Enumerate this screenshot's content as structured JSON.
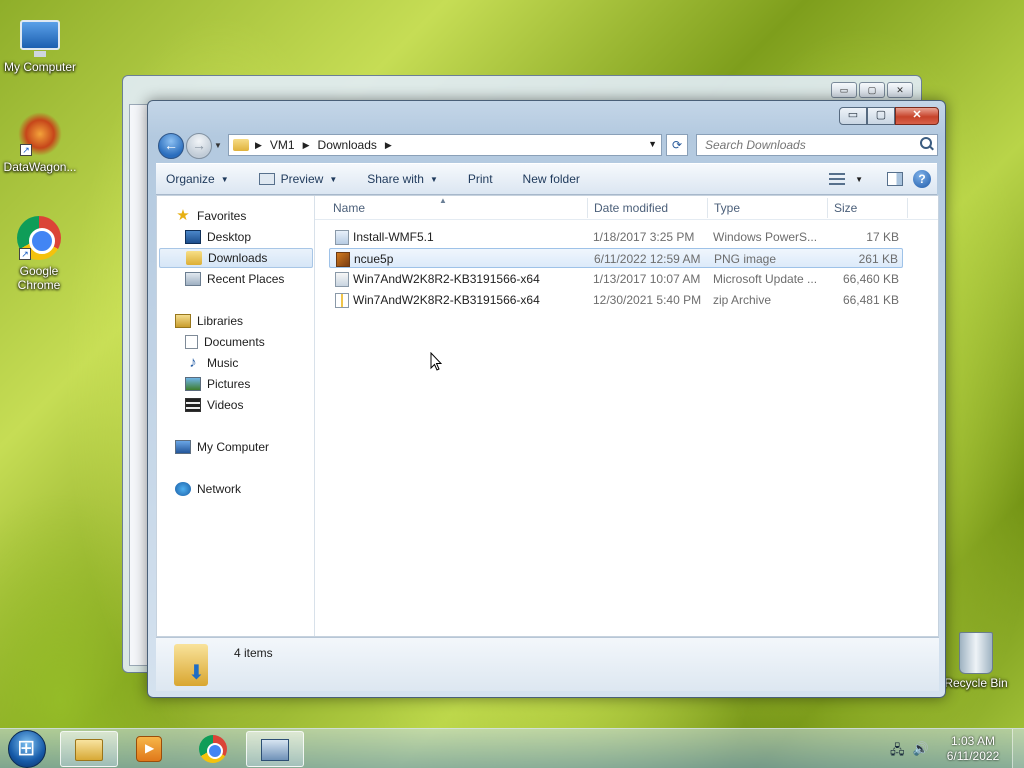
{
  "desktop": {
    "icons": [
      {
        "label": "My Computer"
      },
      {
        "label": "DataWagon..."
      },
      {
        "label": "Google Chrome"
      },
      {
        "label": "Recycle Bin"
      }
    ]
  },
  "explorer": {
    "caption": {
      "minimize": "▭",
      "maximize": "▢",
      "close": "✕"
    },
    "address": {
      "crumbs": [
        "VM1",
        "Downloads"
      ]
    },
    "search": {
      "placeholder": "Search Downloads"
    },
    "toolbar": {
      "organize": "Organize",
      "preview": "Preview",
      "share_with": "Share with",
      "print": "Print",
      "new_folder": "New folder"
    },
    "nav": {
      "favorites": "Favorites",
      "desktop": "Desktop",
      "downloads": "Downloads",
      "recent_places": "Recent Places",
      "libraries": "Libraries",
      "documents": "Documents",
      "music": "Music",
      "pictures": "Pictures",
      "videos": "Videos",
      "my_computer": "My Computer",
      "network": "Network"
    },
    "columns": {
      "name": "Name",
      "date_modified": "Date modified",
      "type": "Type",
      "size": "Size"
    },
    "files": [
      {
        "name": "Install-WMF5.1",
        "date": "1/18/2017 3:25 PM",
        "type": "Windows PowerS...",
        "size": "17 KB",
        "icon": "powershell-script-icon"
      },
      {
        "name": "ncue5p",
        "date": "6/11/2022 12:59 AM",
        "type": "PNG image",
        "size": "261 KB",
        "icon": "png-image-icon",
        "selected": true
      },
      {
        "name": "Win7AndW2K8R2-KB3191566-x64",
        "date": "1/13/2017 10:07 AM",
        "type": "Microsoft Update ...",
        "size": "66,460 KB",
        "icon": "msu-package-icon"
      },
      {
        "name": "Win7AndW2K8R2-KB3191566-x64",
        "date": "12/30/2021 5:40 PM",
        "type": "zip Archive",
        "size": "66,481 KB",
        "icon": "zip-archive-icon"
      }
    ],
    "details": {
      "count": "4 items"
    }
  },
  "taskbar": {
    "clock": {
      "time": "1:03 AM",
      "date": "6/11/2022"
    }
  }
}
